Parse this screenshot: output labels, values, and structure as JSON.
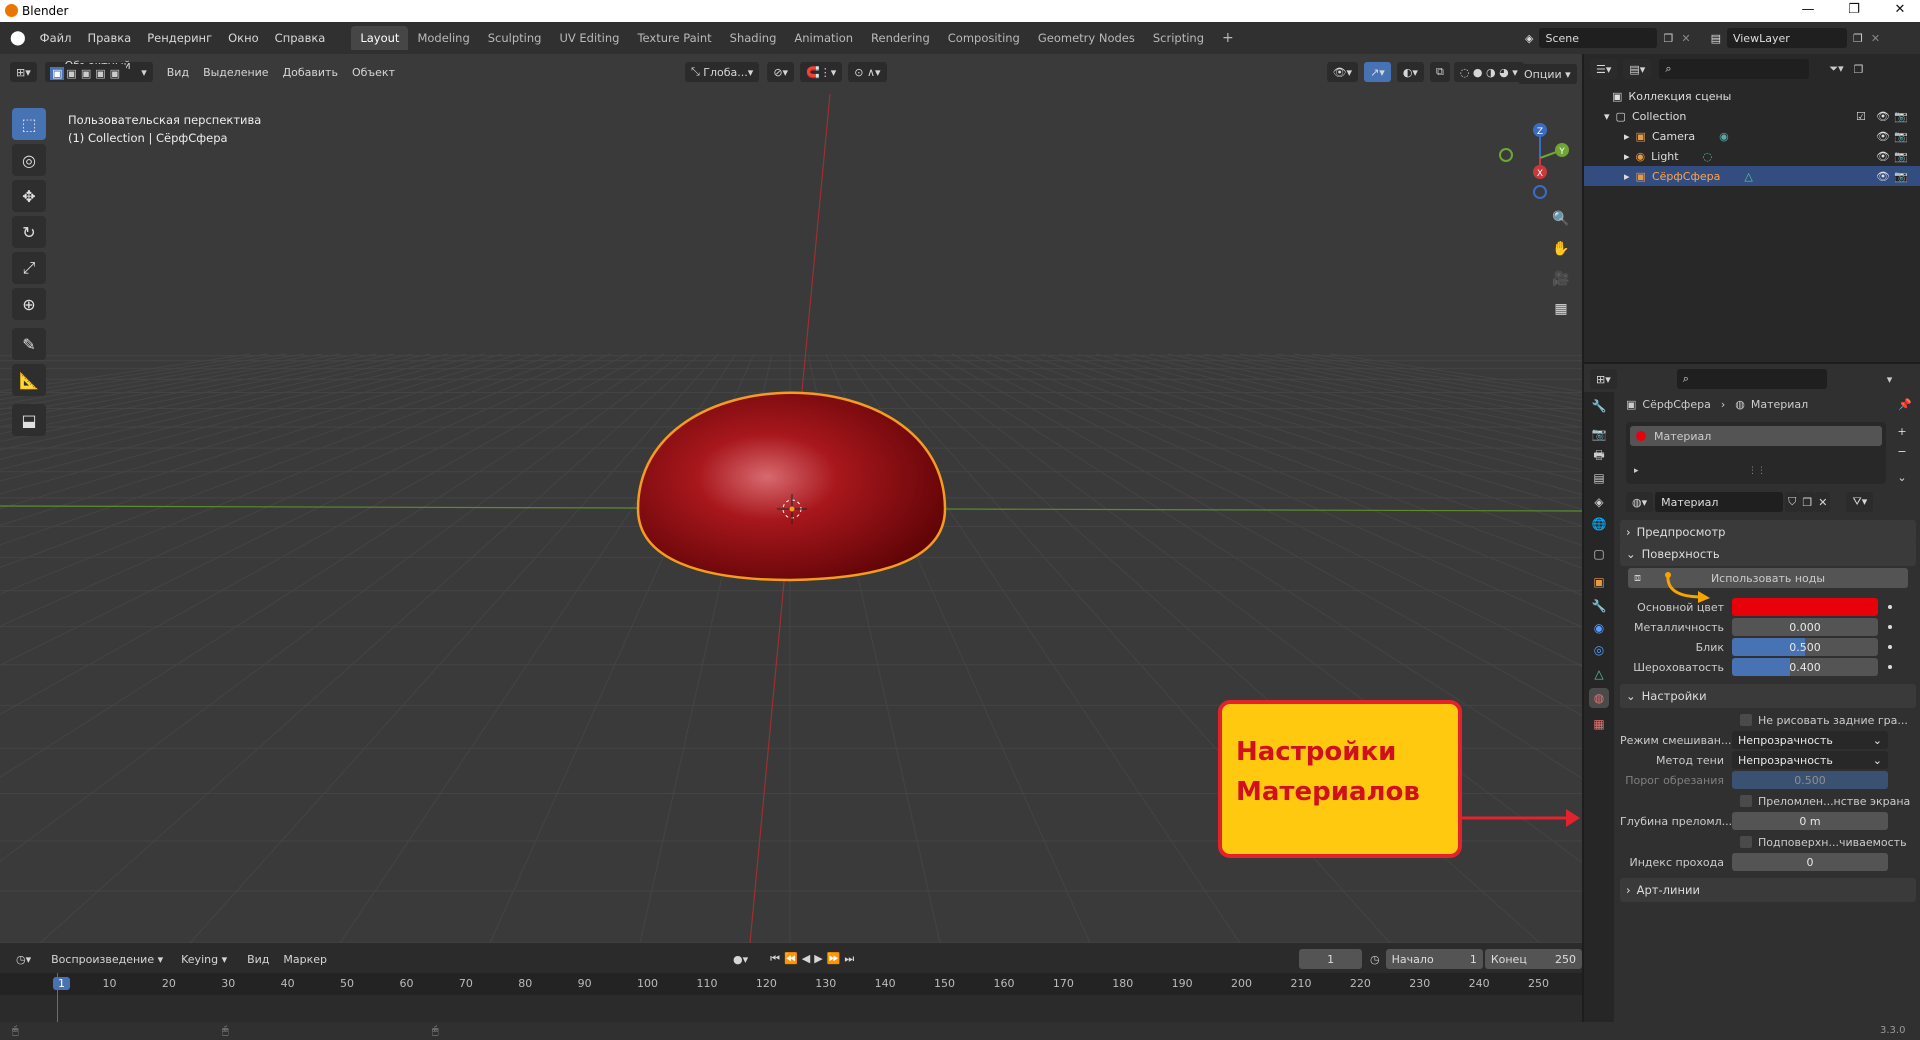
{
  "window": {
    "title": "Blender",
    "buttons": [
      "—",
      "❐",
      "✕"
    ]
  },
  "menubar": {
    "items": [
      "Файл",
      "Правка",
      "Рендеринг",
      "Окно",
      "Справка"
    ]
  },
  "workspaces": [
    "Layout",
    "Modeling",
    "Sculpting",
    "UV Editing",
    "Texture Paint",
    "Shading",
    "Animation",
    "Rendering",
    "Compositing",
    "Geometry Nodes",
    "Scripting"
  ],
  "workspace_add": "+",
  "scene": {
    "name": "Scene",
    "view_layer": "ViewLayer"
  },
  "viewport": {
    "mode": "Объектный ...",
    "menus": [
      "Вид",
      "Выделение",
      "Добавить",
      "Объект"
    ],
    "orientation": "Глоба...",
    "options": "Опции",
    "overlay_line1": "Пользовательская перспектива",
    "overlay_line2": "(1) Collection | СёрфСфера",
    "object_color": "#8f0d10",
    "outline_color": "#f59b1e",
    "gizmo": {
      "z": "Z",
      "y": "Y",
      "x": "X"
    }
  },
  "annotation": {
    "text_line1": "Настройки",
    "text_line2": "Материалов",
    "fill": "#fec90f",
    "border": "#e3222c"
  },
  "outliner": {
    "root": "Коллекция сцены",
    "collection": "Collection",
    "items": [
      "Camera",
      "Light",
      "СёрфСфера"
    ]
  },
  "properties": {
    "breadcrumb_object": "СёрфСфера",
    "breadcrumb_material": "Материал",
    "slot_name": "Материал",
    "material_name": "Материал",
    "panels": {
      "preview": "Предпросмотр",
      "surface": "Поверхность",
      "settings": "Настройки",
      "lineart": "Арт-линии"
    },
    "use_nodes": "Использовать ноды",
    "base_color_label": "Основной цвет",
    "base_color": "#e8000b",
    "metallic": {
      "label": "Металличность",
      "value": "0.000",
      "fraction": 0.0
    },
    "specular": {
      "label": "Блик",
      "value": "0.500",
      "fraction": 0.5
    },
    "roughness": {
      "label": "Шероховатость",
      "value": "0.400",
      "fraction": 0.4
    },
    "backface": "Не рисовать задние гра...",
    "blend_mode": {
      "label": "Режим смешиван...",
      "value": "Непрозрачность"
    },
    "shadow_mode": {
      "label": "Метод тени",
      "value": "Непрозрачность"
    },
    "clip": {
      "label": "Порог обрезания",
      "value": "0.500"
    },
    "refraction": "Преломлен...нстве экрана",
    "refraction_depth": {
      "label": "Глубина преломл...",
      "value": "0 m"
    },
    "sss": "Подповерхн...чиваемость",
    "pass_index": {
      "label": "Индекс прохода",
      "value": "0"
    }
  },
  "timeline": {
    "menus": [
      "Воспроизведение",
      "Keying",
      "Вид",
      "Маркер"
    ],
    "current_frame": "1",
    "start_label": "Начало",
    "start": "1",
    "end_label": "Конец",
    "end": "250",
    "ticks": [
      "1",
      "10",
      "20",
      "30",
      "40",
      "50",
      "60",
      "70",
      "80",
      "90",
      "100",
      "110",
      "120",
      "130",
      "140",
      "150",
      "160",
      "170",
      "180",
      "190",
      "200",
      "210",
      "220",
      "230",
      "240",
      "250"
    ]
  },
  "status": {
    "version": "3.3.0"
  }
}
